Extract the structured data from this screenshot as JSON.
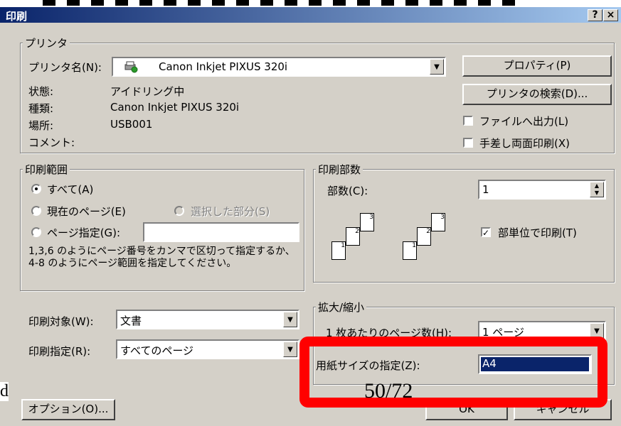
{
  "dialog": {
    "title": "印刷",
    "help_btn": "?",
    "close_btn": "×"
  },
  "printer": {
    "group_label": "プリンタ",
    "name_label": "プリンタ名(N):",
    "name_value": "Canon Inkjet PIXUS 320i",
    "properties_btn": "プロパティ(P)",
    "find_btn": "プリンタの検索(D)...",
    "status_label": "状態:",
    "status_value": "アイドリング中",
    "type_label": "種類:",
    "type_value": "Canon Inkjet PIXUS 320i",
    "where_label": "場所:",
    "where_value": "USB001",
    "comment_label": "コメント:",
    "print_to_file": "ファイルへ出力(L)",
    "manual_duplex": "手差し両面印刷(X)"
  },
  "range": {
    "group_label": "印刷範囲",
    "all": "すべて(A)",
    "current": "現在のページ(E)",
    "selection": "選択した部分(S)",
    "pages": "ページ指定(G):",
    "pages_value": "",
    "hint": "1,3,6 のようにページ番号をカンマで区切って指定するか、4-8 のようにページ範囲を指定してください。"
  },
  "copies": {
    "group_label": "印刷部数",
    "count_label": "部数(C):",
    "count_value": "1",
    "collate": "部単位で印刷(T)",
    "page_numbers": [
      "3",
      "2",
      "1",
      "3",
      "2",
      "1"
    ]
  },
  "print_what": {
    "label": "印刷対象(W):",
    "value": "文書"
  },
  "print_spec": {
    "label": "印刷指定(R):",
    "value": "すべてのページ"
  },
  "zoom": {
    "group_label": "拡大/縮小",
    "pages_per_sheet_label": "1 枚あたりのページ数(H):",
    "pages_per_sheet_value": "1 ページ",
    "paper_size_label": "用紙サイズの指定(Z):",
    "paper_size_value": "A4"
  },
  "footer": {
    "options_btn": "オプション(O)...",
    "ok_btn": "OK",
    "cancel_btn": "キャンセル",
    "slide_number": "50/72",
    "left_text": "d."
  }
}
